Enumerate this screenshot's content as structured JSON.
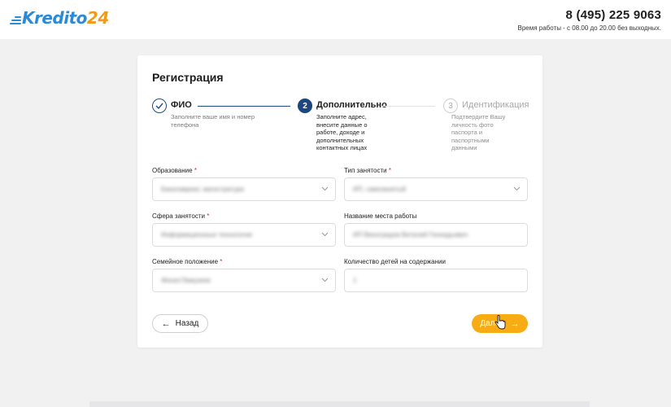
{
  "header": {
    "logo_main": "Kredito",
    "logo_num": "24",
    "phone": "8 (495) 225 9063",
    "hours": "Время работы - с 08.00 до 20.00 без выходных."
  },
  "form": {
    "title": "Регистрация",
    "steps": [
      {
        "number": "",
        "label": "ФИО",
        "description": "Заполните ваше имя и номер телефона",
        "state": "done"
      },
      {
        "number": "2",
        "label": "Дополнительно",
        "description": "Заполните адрес, внесите данные о работе, доходе и дополнительных контактных лицах",
        "state": "active"
      },
      {
        "number": "3",
        "label": "Идентификация",
        "description": "Подтвердите Вашу личность фото паспорта и паспортными данными",
        "state": "pending"
      }
    ],
    "fields": [
      {
        "label": "Образование",
        "required_mark": "*",
        "value": "Бакалавриат, магистратура",
        "type": "select"
      },
      {
        "label": "Тип занятости",
        "required_mark": "*",
        "value": "ИП, самозанятый",
        "type": "select"
      },
      {
        "label": "Сфера занятости",
        "required_mark": "*",
        "value": "Информационные технологии",
        "type": "select"
      },
      {
        "label": "Название места работы",
        "required_mark": "",
        "value": "ИП Виноградов Виталий Геннадьевич",
        "type": "text"
      },
      {
        "label": "Семейное положение",
        "required_mark": "*",
        "value": "Женат/Замужем",
        "type": "select"
      },
      {
        "label": "Количество детей на содержании",
        "required_mark": "",
        "value": "1",
        "type": "text"
      }
    ],
    "back_label": "Назад",
    "next_label": "Далее"
  },
  "colors": {
    "accent_blue": "#1b467f",
    "button_orange": "#f8ac13",
    "required_red": "#d42a2a"
  }
}
